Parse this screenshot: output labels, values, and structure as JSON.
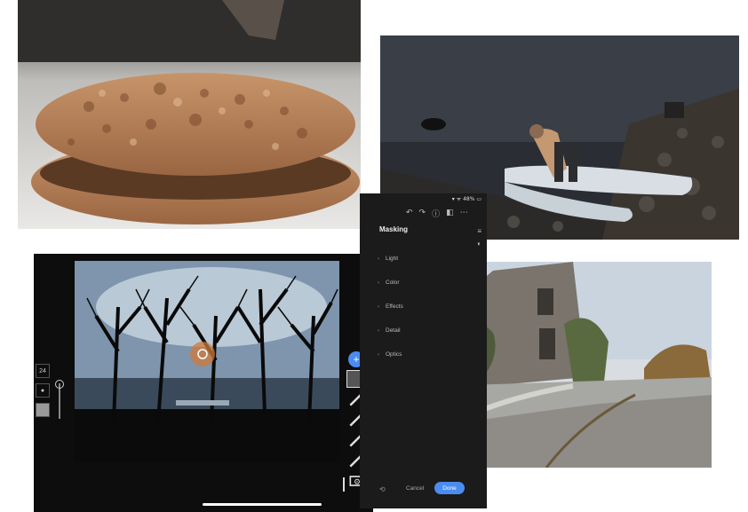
{
  "tablet_editor": {
    "left_tools": [
      "24",
      "●",
      ""
    ],
    "right_rail": [
      "+",
      "",
      "",
      "",
      "",
      "",
      "",
      ""
    ]
  },
  "masking_panel": {
    "status_text": "▾ ᯤ 48% ▭",
    "title": "Masking",
    "sections": [
      {
        "label": "Light"
      },
      {
        "label": "Color"
      },
      {
        "label": "Effects"
      },
      {
        "label": "Detail"
      },
      {
        "label": "Optics"
      }
    ],
    "cancel_label": "Cancel",
    "done_label": "Done"
  },
  "colors": {
    "accent": "#4a8cf0",
    "panel_bg": "#1b1b1b",
    "editor_bg": "#0d0d0d"
  }
}
